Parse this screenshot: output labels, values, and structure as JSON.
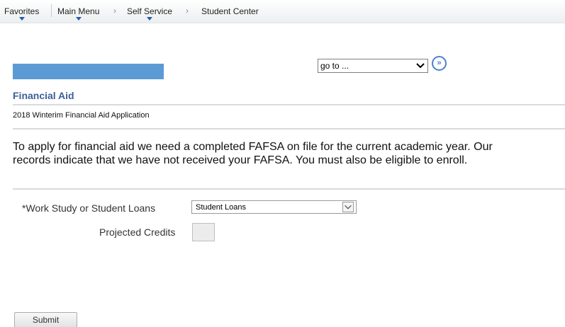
{
  "nav": {
    "favorites": "Favorites",
    "main_menu": "Main Menu",
    "self_service": "Self Service",
    "student_center": "Student Center",
    "separator": "›"
  },
  "goto": {
    "selected": "go to ...",
    "button_glyph": "»"
  },
  "page": {
    "section_title": "Financial Aid",
    "application_title": "2018 Winterim Financial Aid Application",
    "message": "To apply for financial aid we need a completed FAFSA on file for the current academic year.  Our records indicate that we have not received your FAFSA.  You must also be eligible to enroll."
  },
  "form": {
    "work_study_label": "*Work Study or Student Loans",
    "work_study_value": "Student Loans",
    "credits_label": "Projected Credits",
    "submit_label": "Submit"
  },
  "colors": {
    "accent": "#3e5f9a",
    "blue_bar": "#5b9bd5",
    "link_blue": "#4d7fd1"
  }
}
